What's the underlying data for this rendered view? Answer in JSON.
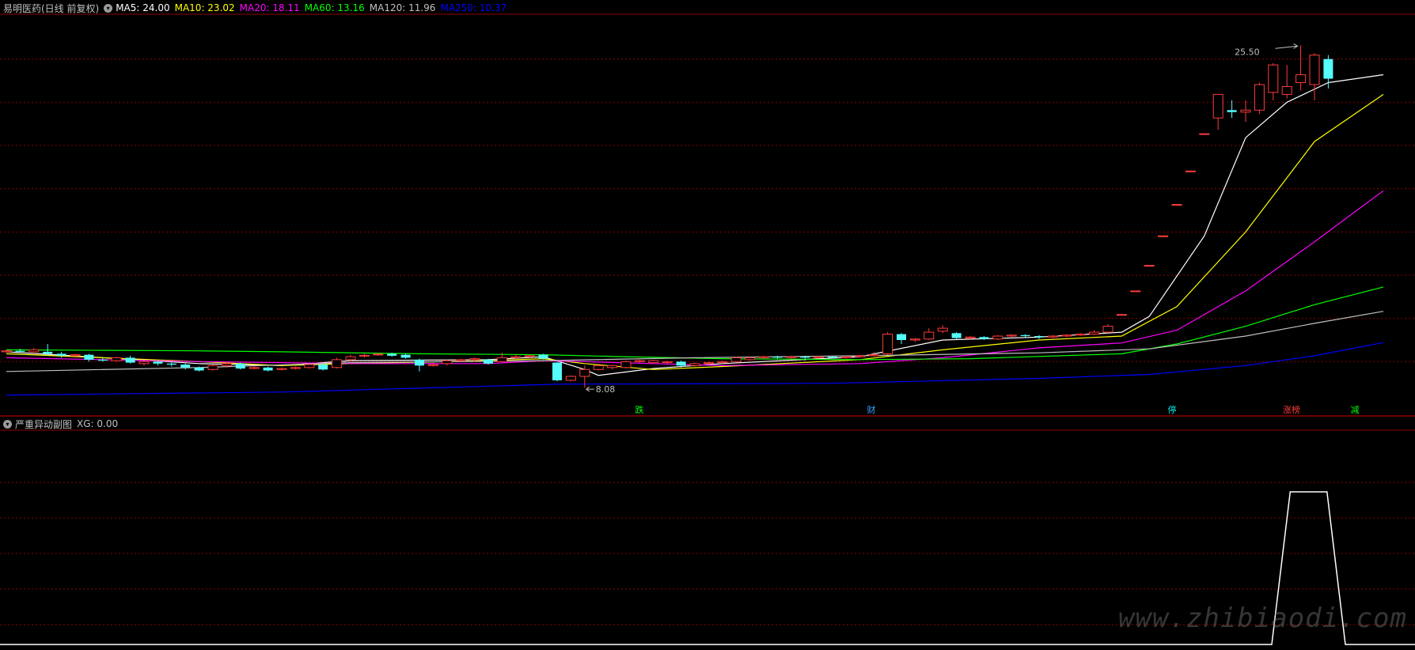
{
  "header": {
    "stock_name": "易明医药(日线 前复权)",
    "ma": [
      {
        "label": "MA5: 24.00",
        "color": "#ffffff"
      },
      {
        "label": "MA10: 23.02",
        "color": "#ffff00"
      },
      {
        "label": "MA20: 18.11",
        "color": "#ff00ff"
      },
      {
        "label": "MA60: 13.16",
        "color": "#00ff00"
      },
      {
        "label": "MA120: 11.96",
        "color": "#c0c0c0"
      },
      {
        "label": "MA250: 10.37",
        "color": "#0000ff"
      }
    ]
  },
  "sub_header": {
    "name": "严重异动副图",
    "value": "XG: 0.00"
  },
  "annotations": {
    "high_label": "25.50",
    "low_label": "8.08"
  },
  "event_markers": [
    {
      "text": "跌",
      "color": "#00ff00"
    },
    {
      "text": "财",
      "color": "#3aa0ff"
    },
    {
      "text": "停",
      "color": "#00e5e5"
    },
    {
      "text": "涨榜",
      "color": "#ff3b3b"
    },
    {
      "text": "减",
      "color": "#00ff00"
    }
  ],
  "watermark": "www.zhibiaodi.com",
  "colors": {
    "up": "#ff3b3b",
    "down": "#54fcfc",
    "grid": "#8c0000",
    "ma5": "#ffffff",
    "ma10": "#ffff00",
    "ma20": "#ff00ff",
    "ma60": "#00ff00",
    "ma120": "#c0c0c0",
    "ma250": "#0000ff"
  },
  "chart_data": {
    "type": "candlestick",
    "ylim": [
      7.2,
      27.0
    ],
    "candles": [
      {
        "o": 9.9,
        "c": 9.95,
        "h": 10.0,
        "l": 9.85
      },
      {
        "o": 9.95,
        "c": 9.9,
        "h": 10.05,
        "l": 9.85
      },
      {
        "o": 9.9,
        "c": 10.0,
        "h": 10.1,
        "l": 9.8
      },
      {
        "o": 9.9,
        "c": 9.8,
        "h": 10.3,
        "l": 9.7
      },
      {
        "o": 9.8,
        "c": 9.7,
        "h": 9.9,
        "l": 9.6
      },
      {
        "o": 9.7,
        "c": 9.75,
        "h": 9.8,
        "l": 9.6
      },
      {
        "o": 9.75,
        "c": 9.5,
        "h": 9.8,
        "l": 9.4
      },
      {
        "o": 9.5,
        "c": 9.45,
        "h": 9.6,
        "l": 9.4
      },
      {
        "o": 9.45,
        "c": 9.6,
        "h": 9.65,
        "l": 9.4
      },
      {
        "o": 9.6,
        "c": 9.35,
        "h": 9.7,
        "l": 9.3
      },
      {
        "o": 9.3,
        "c": 9.4,
        "h": 9.45,
        "l": 9.2
      },
      {
        "o": 9.4,
        "c": 9.3,
        "h": 9.45,
        "l": 9.2
      },
      {
        "o": 9.3,
        "c": 9.25,
        "h": 9.35,
        "l": 9.15
      },
      {
        "o": 9.25,
        "c": 9.1,
        "h": 9.3,
        "l": 9.0
      },
      {
        "o": 9.1,
        "c": 8.95,
        "h": 9.15,
        "l": 8.9
      },
      {
        "o": 9.0,
        "c": 9.2,
        "h": 9.25,
        "l": 8.95
      },
      {
        "o": 9.2,
        "c": 9.3,
        "h": 9.35,
        "l": 9.1
      },
      {
        "o": 9.3,
        "c": 9.05,
        "h": 9.35,
        "l": 9.0
      },
      {
        "o": 9.05,
        "c": 9.1,
        "h": 9.2,
        "l": 9.0
      },
      {
        "o": 9.1,
        "c": 8.95,
        "h": 9.15,
        "l": 8.9
      },
      {
        "o": 9.0,
        "c": 9.05,
        "h": 9.1,
        "l": 8.95
      },
      {
        "o": 9.05,
        "c": 9.1,
        "h": 9.15,
        "l": 9.0
      },
      {
        "o": 9.1,
        "c": 9.25,
        "h": 9.3,
        "l": 9.05
      },
      {
        "o": 9.25,
        "c": 9.0,
        "h": 9.3,
        "l": 8.95
      },
      {
        "o": 9.1,
        "c": 9.5,
        "h": 9.6,
        "l": 9.05
      },
      {
        "o": 9.5,
        "c": 9.65,
        "h": 9.75,
        "l": 9.4
      },
      {
        "o": 9.7,
        "c": 9.72,
        "h": 9.8,
        "l": 9.6
      },
      {
        "o": 9.75,
        "c": 9.78,
        "h": 9.85,
        "l": 9.7
      },
      {
        "o": 9.8,
        "c": 9.7,
        "h": 9.85,
        "l": 9.65
      },
      {
        "o": 9.75,
        "c": 9.6,
        "h": 9.8,
        "l": 9.55
      },
      {
        "o": 9.5,
        "c": 9.2,
        "h": 9.55,
        "l": 8.9
      },
      {
        "o": 9.2,
        "c": 9.25,
        "h": 9.35,
        "l": 9.15
      },
      {
        "o": 9.3,
        "c": 9.45,
        "h": 9.5,
        "l": 9.2
      },
      {
        "o": 9.45,
        "c": 9.5,
        "h": 9.55,
        "l": 9.4
      },
      {
        "o": 9.5,
        "c": 9.55,
        "h": 9.6,
        "l": 9.4
      },
      {
        "o": 9.5,
        "c": 9.3,
        "h": 9.55,
        "l": 9.25
      },
      {
        "o": 9.4,
        "c": 9.6,
        "h": 9.85,
        "l": 9.35
      },
      {
        "o": 9.6,
        "c": 9.65,
        "h": 9.75,
        "l": 9.55
      },
      {
        "o": 9.65,
        "c": 9.7,
        "h": 9.75,
        "l": 9.6
      },
      {
        "o": 9.75,
        "c": 9.55,
        "h": 9.8,
        "l": 9.5
      },
      {
        "o": 9.35,
        "c": 8.45,
        "h": 9.4,
        "l": 8.4
      },
      {
        "o": 8.45,
        "c": 8.65,
        "h": 8.7,
        "l": 8.4
      },
      {
        "o": 8.65,
        "c": 9.0,
        "h": 9.2,
        "l": 8.08
      },
      {
        "o": 9.0,
        "c": 9.2,
        "h": 9.3,
        "l": 8.95
      },
      {
        "o": 9.1,
        "c": 9.2,
        "h": 9.25,
        "l": 9.0
      },
      {
        "o": 9.1,
        "c": 9.4,
        "h": 9.45,
        "l": 9.05
      },
      {
        "o": 9.4,
        "c": 9.45,
        "h": 9.55,
        "l": 9.35
      },
      {
        "o": 9.35,
        "c": 9.45,
        "h": 9.5,
        "l": 9.3
      },
      {
        "o": 9.35,
        "c": 9.4,
        "h": 9.45,
        "l": 9.3
      },
      {
        "o": 9.4,
        "c": 9.2,
        "h": 9.45,
        "l": 9.1
      },
      {
        "o": 9.2,
        "c": 9.3,
        "h": 9.35,
        "l": 9.15
      },
      {
        "o": 9.3,
        "c": 9.35,
        "h": 9.4,
        "l": 9.25
      },
      {
        "o": 9.35,
        "c": 9.4,
        "h": 9.45,
        "l": 9.3
      },
      {
        "o": 9.4,
        "c": 9.6,
        "h": 9.65,
        "l": 9.35
      },
      {
        "o": 9.5,
        "c": 9.6,
        "h": 9.65,
        "l": 9.45
      },
      {
        "o": 9.6,
        "c": 9.65,
        "h": 9.7,
        "l": 9.55
      },
      {
        "o": 9.65,
        "c": 9.6,
        "h": 9.7,
        "l": 9.55
      },
      {
        "o": 9.6,
        "c": 9.65,
        "h": 9.7,
        "l": 9.55
      },
      {
        "o": 9.65,
        "c": 9.6,
        "h": 9.7,
        "l": 9.45
      },
      {
        "o": 9.6,
        "c": 9.65,
        "h": 9.7,
        "l": 9.55
      },
      {
        "o": 9.65,
        "c": 9.6,
        "h": 9.7,
        "l": 9.55
      },
      {
        "o": 9.6,
        "c": 9.65,
        "h": 9.7,
        "l": 9.55
      },
      {
        "o": 9.65,
        "c": 9.7,
        "h": 9.75,
        "l": 9.6
      },
      {
        "o": 9.7,
        "c": 9.75,
        "h": 9.9,
        "l": 9.65
      },
      {
        "o": 9.8,
        "c": 10.8,
        "h": 10.9,
        "l": 9.75
      },
      {
        "o": 10.8,
        "c": 10.5,
        "h": 10.85,
        "l": 10.3
      },
      {
        "o": 10.5,
        "c": 10.55,
        "h": 10.6,
        "l": 10.4
      },
      {
        "o": 10.55,
        "c": 10.9,
        "h": 11.1,
        "l": 10.5
      },
      {
        "o": 10.95,
        "c": 11.1,
        "h": 11.25,
        "l": 10.85
      },
      {
        "o": 10.85,
        "c": 10.6,
        "h": 10.9,
        "l": 10.55
      },
      {
        "o": 10.6,
        "c": 10.65,
        "h": 10.7,
        "l": 10.5
      },
      {
        "o": 10.65,
        "c": 10.55,
        "h": 10.7,
        "l": 10.5
      },
      {
        "o": 10.55,
        "c": 10.7,
        "h": 10.75,
        "l": 10.5
      },
      {
        "o": 10.7,
        "c": 10.75,
        "h": 10.8,
        "l": 10.65
      },
      {
        "o": 10.75,
        "c": 10.7,
        "h": 10.8,
        "l": 10.65
      },
      {
        "o": 10.7,
        "c": 10.65,
        "h": 10.75,
        "l": 10.55
      },
      {
        "o": 10.65,
        "c": 10.7,
        "h": 10.75,
        "l": 10.6
      },
      {
        "o": 10.7,
        "c": 10.75,
        "h": 10.8,
        "l": 10.65
      },
      {
        "o": 10.75,
        "c": 10.8,
        "h": 10.85,
        "l": 10.7
      },
      {
        "o": 10.8,
        "c": 10.9,
        "h": 11.0,
        "l": 10.75
      },
      {
        "o": 10.9,
        "c": 11.2,
        "h": 11.3,
        "l": 10.85
      },
      {
        "o": 11.8,
        "c": 11.8,
        "h": 11.8,
        "l": 11.8
      },
      {
        "o": 13.0,
        "c": 13.0,
        "h": 13.0,
        "l": 13.0
      },
      {
        "o": 14.3,
        "c": 14.3,
        "h": 14.3,
        "l": 14.3
      },
      {
        "o": 15.8,
        "c": 15.8,
        "h": 15.8,
        "l": 15.8
      },
      {
        "o": 17.4,
        "c": 17.4,
        "h": 17.4,
        "l": 17.4
      },
      {
        "o": 19.1,
        "c": 19.1,
        "h": 19.1,
        "l": 19.1
      },
      {
        "o": 21.0,
        "c": 21.0,
        "h": 21.0,
        "l": 21.0
      },
      {
        "o": 21.8,
        "c": 23.0,
        "h": 23.0,
        "l": 21.2
      },
      {
        "o": 22.2,
        "c": 22.1,
        "h": 22.7,
        "l": 21.8
      },
      {
        "o": 22.1,
        "c": 22.2,
        "h": 22.7,
        "l": 21.6
      },
      {
        "o": 22.2,
        "c": 23.5,
        "h": 23.6,
        "l": 22.0
      },
      {
        "o": 23.1,
        "c": 24.5,
        "h": 24.6,
        "l": 22.7
      },
      {
        "o": 23.0,
        "c": 23.4,
        "h": 24.5,
        "l": 22.8
      },
      {
        "o": 23.6,
        "c": 24.0,
        "h": 25.5,
        "l": 23.2
      },
      {
        "o": 23.5,
        "c": 25.0,
        "h": 25.1,
        "l": 22.7
      },
      {
        "o": 24.8,
        "c": 23.8,
        "h": 25.0,
        "l": 23.3
      }
    ],
    "ma_lines": [
      {
        "name": "MA5",
        "color": "#ffffff",
        "values": [
          [
            0,
            9.9
          ],
          [
            14,
            9.3
          ],
          [
            20,
            9.2
          ],
          [
            25,
            9.45
          ],
          [
            35,
            9.5
          ],
          [
            39,
            9.65
          ],
          [
            42,
            9.0
          ],
          [
            43,
            8.7
          ],
          [
            47,
            9.05
          ],
          [
            52,
            9.3
          ],
          [
            62,
            9.65
          ],
          [
            68,
            10.5
          ],
          [
            75,
            10.65
          ],
          [
            81,
            10.9
          ],
          [
            83,
            11.7
          ],
          [
            87,
            15.8
          ],
          [
            90,
            20.8
          ],
          [
            93,
            22.6
          ],
          [
            96,
            23.6
          ],
          [
            100,
            24.0
          ]
        ]
      },
      {
        "name": "MA10",
        "color": "#ffff00",
        "values": [
          [
            0,
            9.8
          ],
          [
            14,
            9.4
          ],
          [
            20,
            9.2
          ],
          [
            25,
            9.3
          ],
          [
            35,
            9.45
          ],
          [
            39,
            9.55
          ],
          [
            42,
            9.3
          ],
          [
            47,
            9.0
          ],
          [
            52,
            9.15
          ],
          [
            62,
            9.5
          ],
          [
            68,
            10.0
          ],
          [
            75,
            10.5
          ],
          [
            81,
            10.7
          ],
          [
            85,
            12.2
          ],
          [
            90,
            16.0
          ],
          [
            95,
            20.6
          ],
          [
            100,
            23.0
          ]
        ]
      },
      {
        "name": "MA20",
        "color": "#ff00ff",
        "values": [
          [
            0,
            9.6
          ],
          [
            14,
            9.4
          ],
          [
            20,
            9.35
          ],
          [
            25,
            9.3
          ],
          [
            35,
            9.3
          ],
          [
            39,
            9.45
          ],
          [
            42,
            9.4
          ],
          [
            47,
            9.3
          ],
          [
            52,
            9.2
          ],
          [
            62,
            9.3
          ],
          [
            68,
            9.6
          ],
          [
            75,
            10.1
          ],
          [
            81,
            10.35
          ],
          [
            85,
            11.0
          ],
          [
            90,
            13.0
          ],
          [
            95,
            15.5
          ],
          [
            100,
            18.1
          ]
        ]
      },
      {
        "name": "MA60",
        "color": "#00ff00",
        "values": [
          [
            0,
            10.0
          ],
          [
            14,
            9.95
          ],
          [
            20,
            9.9
          ],
          [
            30,
            9.8
          ],
          [
            39,
            9.75
          ],
          [
            45,
            9.65
          ],
          [
            52,
            9.55
          ],
          [
            62,
            9.5
          ],
          [
            70,
            9.55
          ],
          [
            81,
            9.8
          ],
          [
            85,
            10.3
          ],
          [
            90,
            11.2
          ],
          [
            95,
            12.3
          ],
          [
            100,
            13.2
          ]
        ]
      },
      {
        "name": "MA120",
        "color": "#c0c0c0",
        "values": [
          [
            0,
            8.9
          ],
          [
            14,
            9.1
          ],
          [
            25,
            9.35
          ],
          [
            39,
            9.45
          ],
          [
            50,
            9.6
          ],
          [
            62,
            9.7
          ],
          [
            75,
            9.85
          ],
          [
            83,
            10.05
          ],
          [
            90,
            10.7
          ],
          [
            95,
            11.35
          ],
          [
            100,
            11.96
          ]
        ]
      },
      {
        "name": "MA250",
        "color": "#0000ff",
        "values": [
          [
            0,
            7.7
          ],
          [
            20,
            7.85
          ],
          [
            40,
            8.25
          ],
          [
            60,
            8.3
          ],
          [
            75,
            8.55
          ],
          [
            83,
            8.75
          ],
          [
            90,
            9.2
          ],
          [
            95,
            9.7
          ],
          [
            100,
            10.37
          ]
        ]
      }
    ],
    "sub_series": {
      "name": "XG",
      "ylim": [
        0,
        1
      ],
      "points": [
        [
          0,
          0
        ],
        [
          89,
          0
        ],
        [
          91,
          1
        ],
        [
          95,
          1
        ],
        [
          97,
          0
        ],
        [
          100,
          0
        ]
      ]
    }
  }
}
